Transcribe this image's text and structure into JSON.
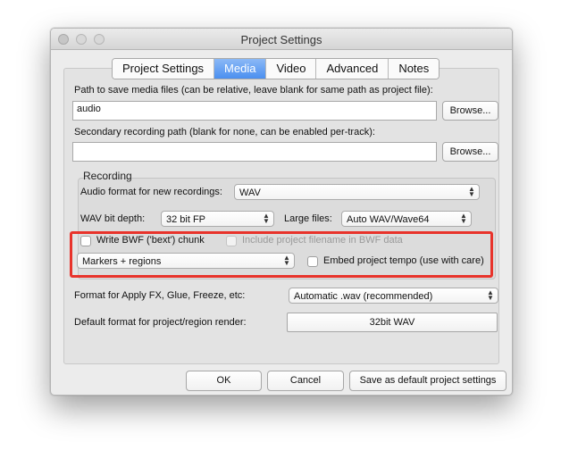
{
  "window": {
    "title": "Project Settings"
  },
  "tabs": [
    {
      "label": "Project Settings",
      "active": false
    },
    {
      "label": "Media",
      "active": true
    },
    {
      "label": "Video",
      "active": false
    },
    {
      "label": "Advanced",
      "active": false
    },
    {
      "label": "Notes",
      "active": false
    }
  ],
  "media_path": {
    "label": "Path to save media files (can be relative, leave blank for same path as project file):",
    "value": "audio",
    "browse_label": "Browse..."
  },
  "secondary_path": {
    "label": "Secondary recording path (blank for none, can be enabled per-track):",
    "value": "",
    "browse_label": "Browse..."
  },
  "recording": {
    "title": "Recording",
    "format_label": "Audio format for new recordings:",
    "format_value": "WAV",
    "bitdepth_label": "WAV bit depth:",
    "bitdepth_value": "32 bit FP",
    "largefiles_label": "Large files:",
    "largefiles_value": "Auto WAV/Wave64",
    "bwf_label": "Write BWF ('bext') chunk",
    "bwf_checked": false,
    "include_filename_label": "Include project filename in BWF data",
    "include_filename_checked": false,
    "markers_value": "Markers + regions",
    "embed_tempo_label": "Embed project tempo (use with care)",
    "embed_tempo_checked": false
  },
  "apply_fx": {
    "label": "Format for Apply FX, Glue, Freeze, etc:",
    "value": "Automatic .wav (recommended)"
  },
  "render_format": {
    "label": "Default format for project/region render:",
    "value": "32bit WAV"
  },
  "buttons": {
    "ok": "OK",
    "cancel": "Cancel",
    "save_default": "Save as default project settings"
  },
  "colors": {
    "active_tab": "#4b8ff0",
    "highlight": "#e8332b"
  }
}
